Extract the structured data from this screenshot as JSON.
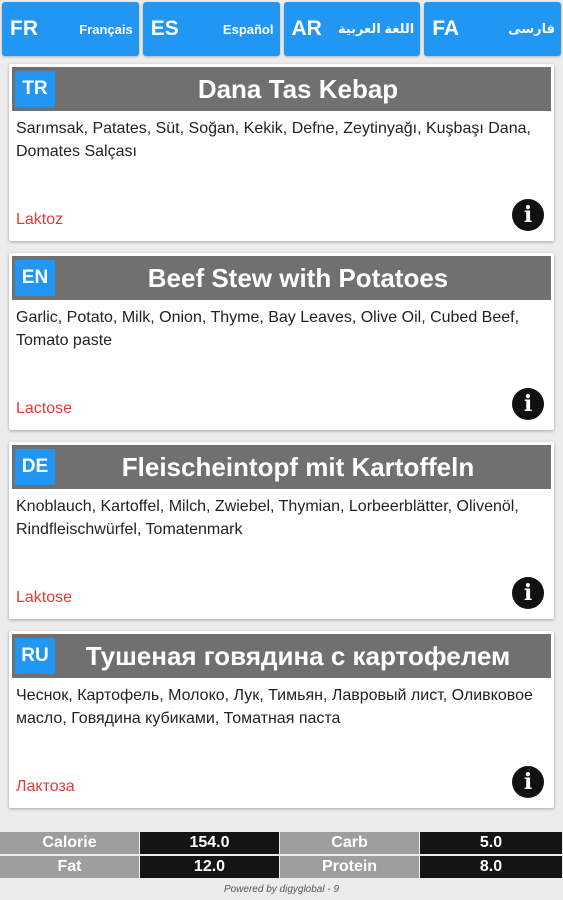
{
  "languages": [
    {
      "code": "FR",
      "name": "Français"
    },
    {
      "code": "ES",
      "name": "Español"
    },
    {
      "code": "AR",
      "name": "اللغة العربية"
    },
    {
      "code": "FA",
      "name": "فارسی"
    }
  ],
  "cards": [
    {
      "code": "TR",
      "title": "Dana Tas Kebap",
      "ingredients": "Sarımsak, Patates, Süt, Soğan, Kekik, Defne, Zeytinyağı, Kuşbaşı Dana, Domates Salçası",
      "allergen": "Laktoz"
    },
    {
      "code": "EN",
      "title": "Beef Stew with Potatoes",
      "ingredients": "Garlic, Potato, Milk, Onion, Thyme, Bay Leaves, Olive Oil, Cubed Beef, Tomato paste",
      "allergen": "Lactose"
    },
    {
      "code": "DE",
      "title": "Fleischeintopf mit Kartoffeln",
      "ingredients": "Knoblauch, Kartoffel, Milch, Zwiebel, Thymian, Lorbeerblätter, Olivenöl, Rindfleischwürfel, Tomatenmark",
      "allergen": "Laktose"
    },
    {
      "code": "RU",
      "title": "Тушеная говядина с картофелем",
      "ingredients": "Чеснок, Картофель, Молоко, Лук, Тимьян, Лавровый лист, Оливковое масло, Говядина кубиками, Томатная паста",
      "allergen": "Лактоза"
    }
  ],
  "nutrition": {
    "calorie_label": "Calorie",
    "calorie_value": "154.0",
    "carb_label": "Carb",
    "carb_value": "5.0",
    "fat_label": "Fat",
    "fat_value": "12.0",
    "protein_label": "Protein",
    "protein_value": "8.0"
  },
  "footer": "Powered by digyglobal - 9",
  "colors": {
    "accent": "#2196f3",
    "header": "#707070",
    "allergen": "#e53935"
  }
}
